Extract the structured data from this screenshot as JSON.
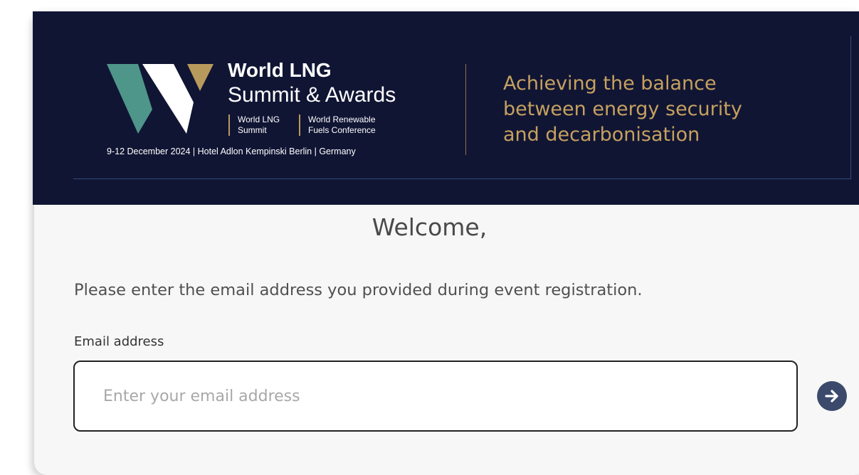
{
  "header": {
    "brand_line1": "World LNG",
    "brand_line2": "Summit & Awards",
    "sub_brands": [
      {
        "line1": "World LNG",
        "line2": "Summit"
      },
      {
        "line1": "World Renewable",
        "line2": "Fuels Conference"
      }
    ],
    "event_meta": "9-12 December 2024  |  Hotel Adlon Kempinski Berlin  |  Germany",
    "tagline": [
      "Achieving the balance",
      "between energy security",
      "and decarbonisation"
    ]
  },
  "login": {
    "welcome": "Welcome,",
    "instruction": "Please enter the email address you provided during event registration.",
    "email_label": "Email address",
    "email_placeholder": "Enter your email address",
    "email_value": ""
  },
  "colors": {
    "banner_bg": "#111534",
    "gold": "#c5a15f",
    "teal": "#4e958a",
    "button": "#3b4a6b"
  },
  "icons": {
    "logo": "world-lng-logo-mark",
    "submit": "arrow-right-circle-icon"
  }
}
